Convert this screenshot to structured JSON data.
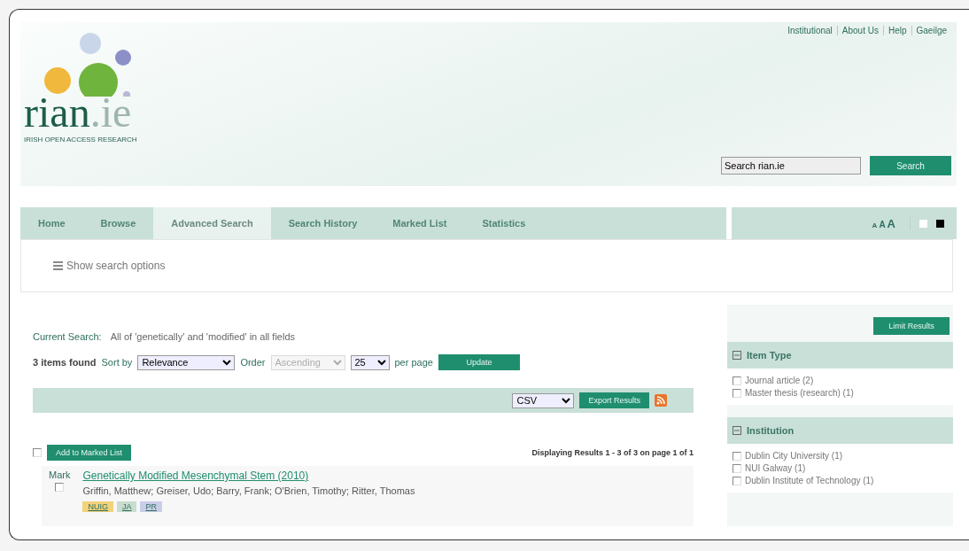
{
  "header": {
    "logo": {
      "name": "rian",
      "suffix": ".ie",
      "tagline": "IRISH OPEN ACCESS RESEARCH"
    },
    "top_links": [
      "Institutional",
      "About Us",
      "Help",
      "Gaeilge"
    ],
    "search": {
      "value": "Search rian.ie",
      "button": "Search"
    }
  },
  "nav": {
    "tabs": [
      {
        "label": "Home",
        "selected": false
      },
      {
        "label": "Browse",
        "selected": false
      },
      {
        "label": "Advanced Search",
        "selected": true
      },
      {
        "label": "Search History",
        "selected": false
      },
      {
        "label": "Marked List",
        "selected": false
      },
      {
        "label": "Statistics",
        "selected": false
      }
    ],
    "font_sizes": [
      "A",
      "A",
      "A"
    ]
  },
  "search_options": "Show search options",
  "results": {
    "current_search_label": "Current Search:",
    "current_search": "All of 'genetically' and 'modified' in all fields",
    "found": "3 items found",
    "sort_label": "Sort by",
    "sort": "Relevance",
    "order_label": "Order",
    "order": "Ascending",
    "order_disabled": true,
    "per_page": "25",
    "per_page_label": "per page",
    "update": "Update",
    "export_format": "CSV",
    "export_button": "Export Results",
    "select_all_checked": false,
    "add_button": "Add to Marked List",
    "displaying": "Displaying Results 1 - 3 of 3 on page 1 of 1",
    "items": [
      {
        "mark_label": "Mark",
        "checked": false,
        "title": "Genetically Modified Mesenchymal Stem (2010)",
        "authors": "Griffin, Matthew; Greiser, Udo; Barry, Frank; O'Brien, Timothy; Ritter, Thomas",
        "tags": [
          {
            "label": "NUIG",
            "color": "#f2d27a"
          },
          {
            "label": "JA",
            "color": "#c8dccf"
          },
          {
            "label": "PR",
            "color": "#c9cde8"
          }
        ]
      }
    ]
  },
  "sidebar": {
    "limit_button": "Limit Results",
    "facets": [
      {
        "title": "Item Type",
        "options": [
          {
            "label": "Journal article (2)",
            "checked": false
          },
          {
            "label": "Master thesis (research) (1)",
            "checked": false
          }
        ]
      },
      {
        "title": "Institution",
        "options": [
          {
            "label": "Dublin City University (1)",
            "checked": false
          },
          {
            "label": "NUI Galway (1)",
            "checked": false
          },
          {
            "label": "Dublin Institute of Technology (1)",
            "checked": false
          }
        ]
      }
    ]
  }
}
